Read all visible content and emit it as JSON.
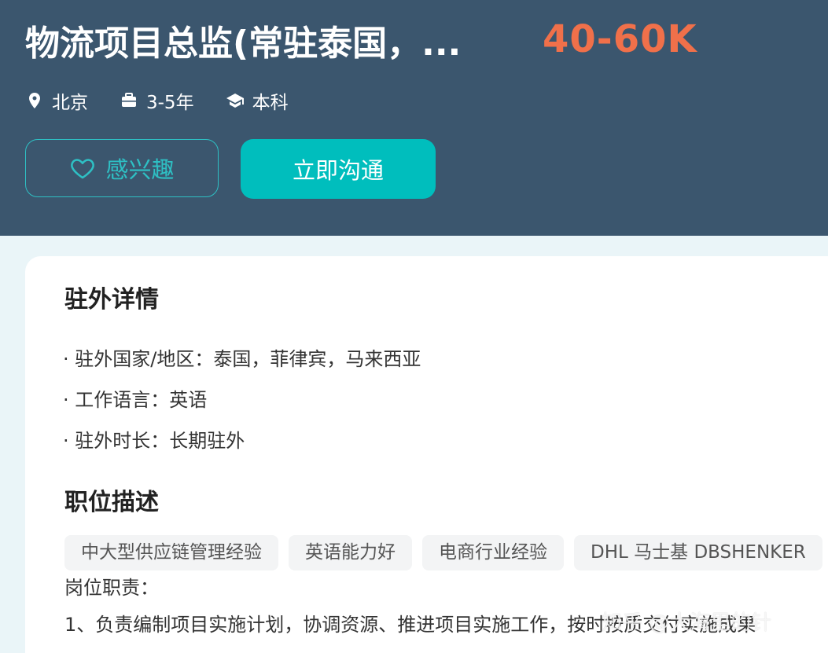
{
  "job": {
    "title": "物流项目总监(常驻泰国，...",
    "salary": "40-60K",
    "meta": [
      {
        "icon": "location-pin-icon",
        "text": "北京"
      },
      {
        "icon": "briefcase-icon",
        "text": "3-5年"
      },
      {
        "icon": "graduation-cap-icon",
        "text": "本科"
      }
    ]
  },
  "actions": {
    "interest_label": "感兴趣",
    "chat_label": "立即沟通"
  },
  "details": {
    "title": "驻外详情",
    "items": [
      "· 驻外国家/地区：泰国，菲律宾，马来西亚",
      "· 工作语言：英语",
      "· 驻外时长：长期驻外"
    ]
  },
  "description": {
    "title": "职位描述",
    "tags": [
      "中大型供应链管理经验",
      "英语能力好",
      "电商行业经验",
      "DHL 马士基 DBSHENKER"
    ],
    "duty_heading": "岗位职责：",
    "duties": [
      "1、负责编制项目实施计划，协调资源、推进项目实施工作，按时按质交付实施成果"
    ]
  },
  "watermark": "知乎 @大海里的针",
  "colors": {
    "header_bg": "#3b566e",
    "salary": "#f0704a",
    "accent": "#00bebd",
    "page_bg": "#eaf5f8"
  }
}
